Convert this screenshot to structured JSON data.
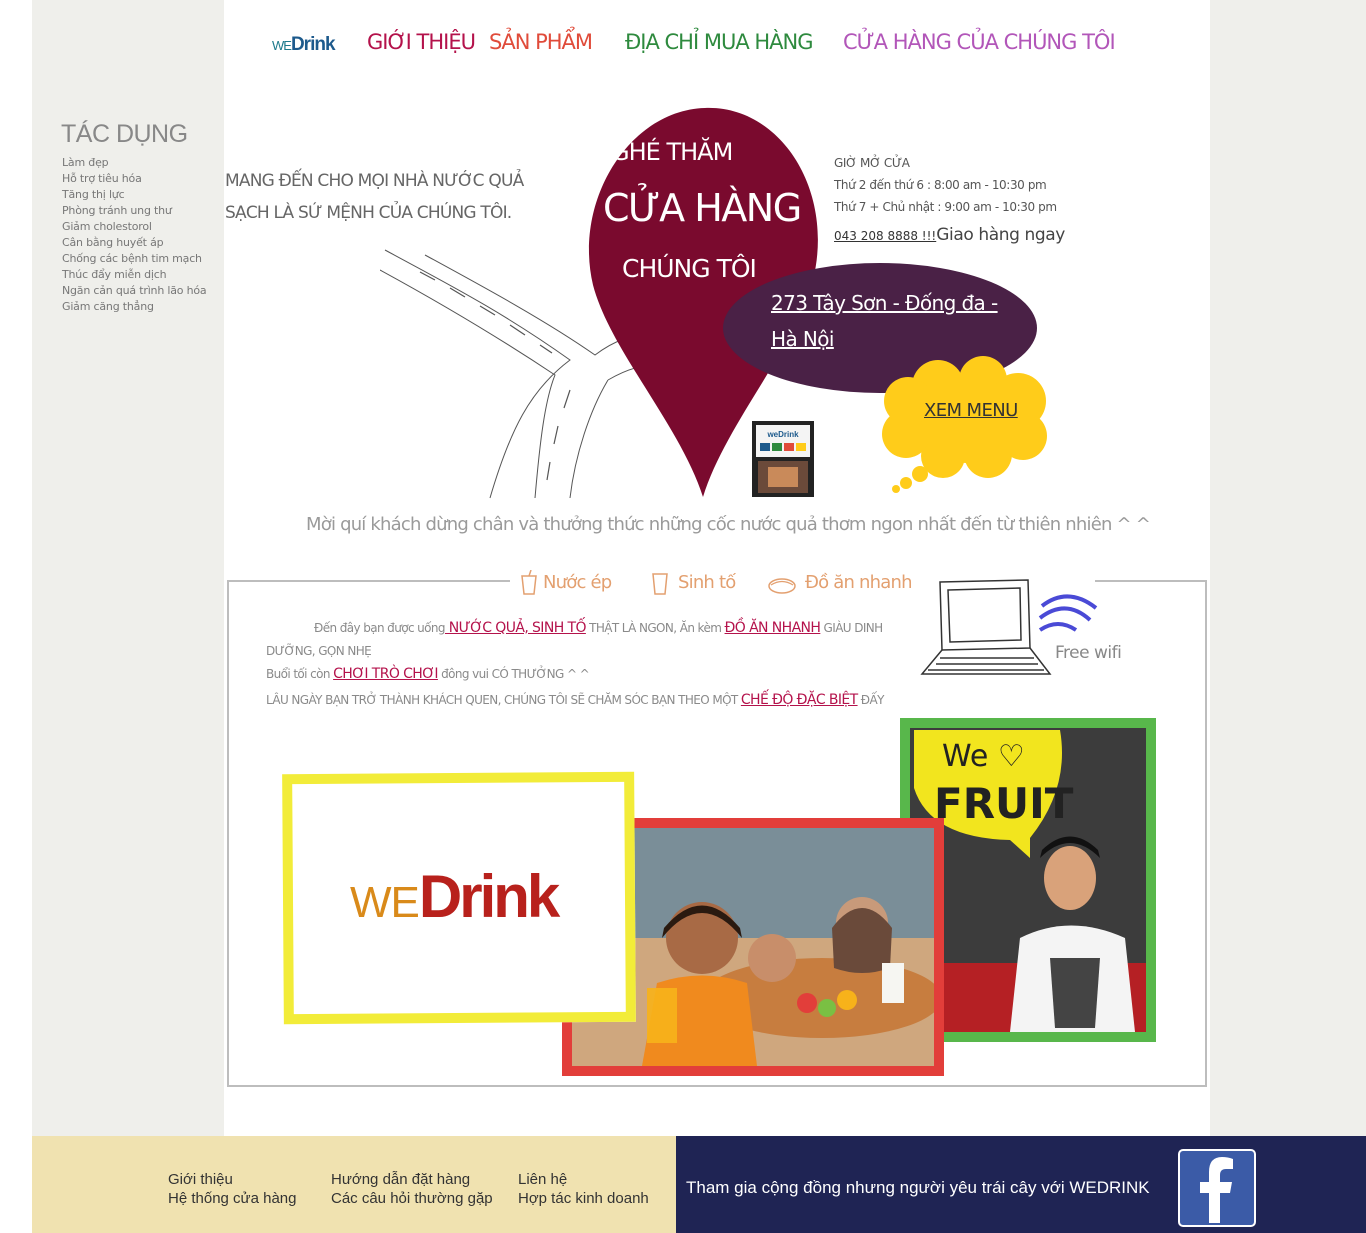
{
  "brand": {
    "logo_we": "WE",
    "logo_drink": "Drink"
  },
  "nav": {
    "items": [
      {
        "label": "GIỚI THIỆU",
        "color": "#b4124b"
      },
      {
        "label": "SẢN PHẨM",
        "color": "#e04b3a"
      },
      {
        "label": "ĐỊA CHỈ MUA HÀNG",
        "color": "#2e8a3e"
      },
      {
        "label": "CỬA HÀNG CỦA CHÚNG TÔI",
        "color": "#b256b9"
      }
    ]
  },
  "sidebar": {
    "title": "TÁC DỤNG",
    "items": [
      "Làm đẹp",
      "Hỗ trợ tiêu hóa",
      "Tăng thị lực",
      "Phòng tránh ung thư",
      "Giảm cholestorol",
      "Cân bằng huyết áp",
      "Chống các bệnh tim mạch",
      "Thúc đẩy miễn dịch",
      "Ngăn cản quá trình lão hóa",
      "Giảm căng thẳng"
    ]
  },
  "mission": {
    "line1": "MANG ĐẾN CHO MỌI NHÀ NƯỚC QUẢ",
    "line2": "SẠCH LÀ SỨ MỆNH CỦA CHÚNG TÔI."
  },
  "pin": {
    "line1": "GHÉ THĂM",
    "line2": "CỬA HÀNG",
    "line3": "CHÚNG TÔI",
    "color": "#7a0a2e"
  },
  "hours": {
    "title": "GIỜ MỞ CỬA",
    "weekday": "Thứ 2 đến thứ 6 : 8:00 am - 10:30 pm",
    "weekend": "Thứ 7 + Chủ nhật : 9:00 am - 10:30 pm",
    "phone": "043 208 8888 !!!",
    "delivery": "Giao hàng ngay"
  },
  "address": {
    "line1": "273 Tây Sơn - Đống đa -",
    "line2": "Hà Nội",
    "color": "#4a2146"
  },
  "menu_link": {
    "label": "XEM MENU",
    "color": "#ffcc1a"
  },
  "invite": "Mời quí khách dừng chân  và thưởng thức những cốc nước quả thơm ngon nhất đến từ thiên nhiên ^ ^",
  "categories": [
    "Nước ép",
    "Sinh tố",
    "Đồ ăn nhanh"
  ],
  "description": {
    "l1_a": "Đến đây bạn được uống",
    "l1_link1": " NƯỚC QUẢ, SINH TỐ",
    "l1_b": " THẬT LÀ NGON, Ăn kèm ",
    "l1_link2": "ĐỒ ĂN NHANH",
    "l1_c": " GIÀU DINH",
    "l2": "DƯỠNG, GỌN NHẸ",
    "l3_a": "Buổi tối còn ",
    "l3_link": "CHƠI TRÒ CHƠI",
    "l3_b": " đông vui CÓ THƯỞNG ^ ^",
    "l4_a": "LÂU NGÀY BẠN TRỞ THÀNH KHÁCH QUEN, CHÚNG TÔI SẼ CHĂM SÓC BẠN THEO MỘT ",
    "l4_link": "CHẾ ĐỘ ĐẶC BIỆT",
    "l4_b": " ĐẤY"
  },
  "wifi": {
    "label": "Free wifi"
  },
  "photos": {
    "big_logo_we": "WE",
    "big_logo_drink": "Drink",
    "sign_line1": "We ♡",
    "sign_line2": "FRUIT"
  },
  "footer": {
    "links": [
      "Giới thiệu",
      "Hệ thống cửa hàng",
      "Hướng dẫn đặt hàng",
      "Các câu hỏi thường gặp",
      "Liên hệ",
      "Hợp tác kinh doanh"
    ],
    "community": "Tham gia cộng đồng nhưng người yêu trái cây với WEDRINK",
    "social_icon": "facebook-icon"
  }
}
